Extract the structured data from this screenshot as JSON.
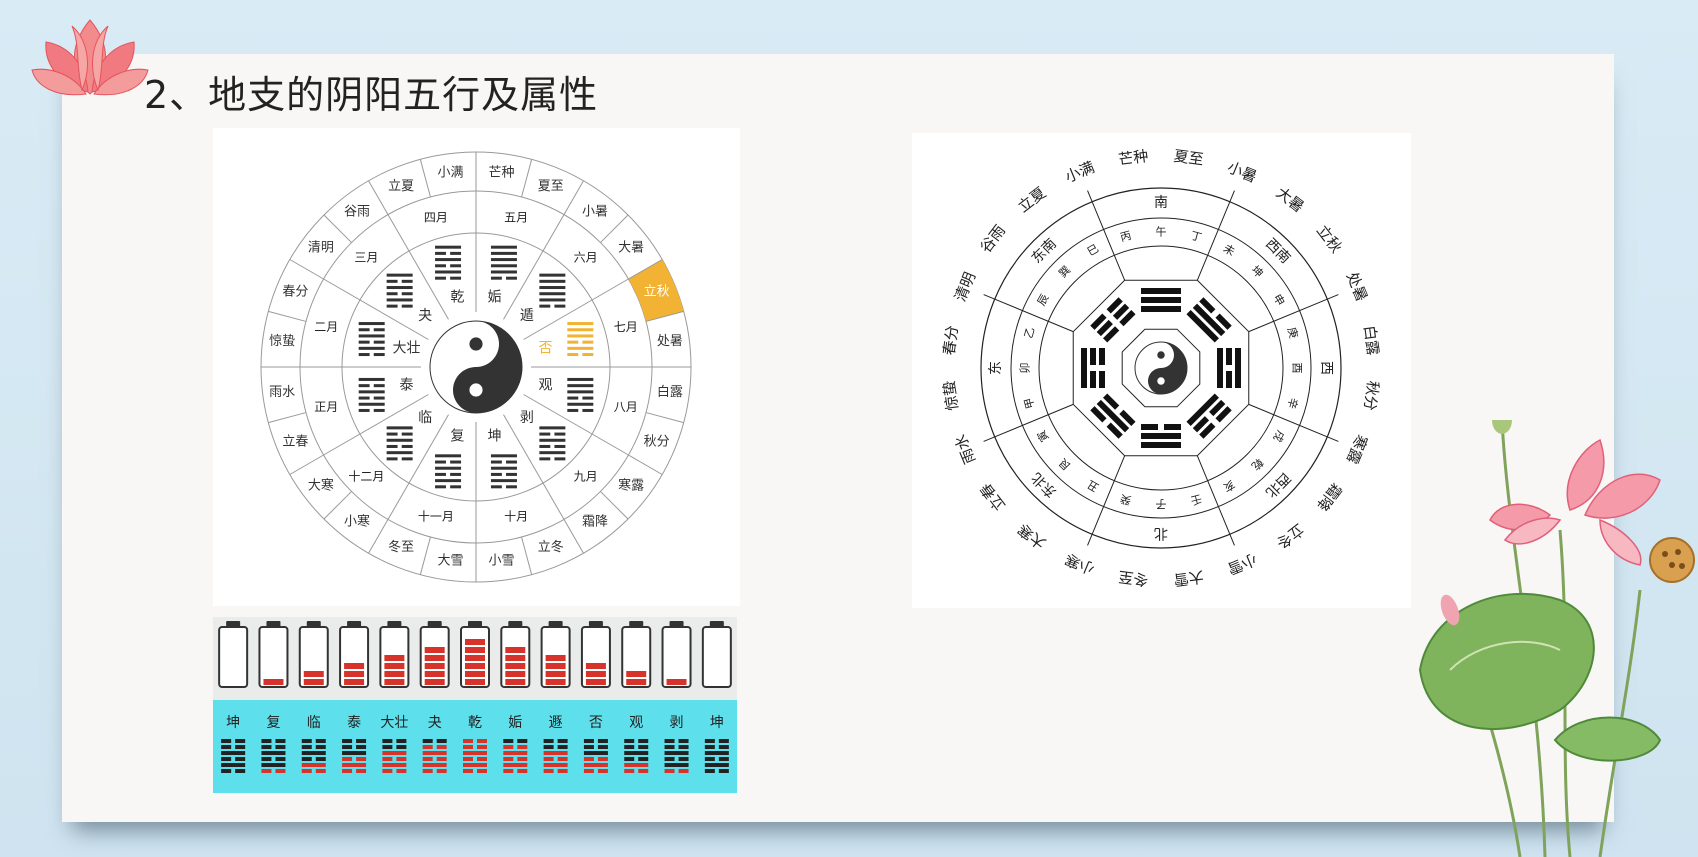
{
  "title": "2、地支的阴阳五行及属性",
  "wheel1": {
    "solar_terms": [
      "芒种",
      "夏至",
      "小暑",
      "大暑",
      "立秋",
      "处暑",
      "白露",
      "秋分",
      "寒露",
      "霜降",
      "立冬",
      "小雪",
      "大雪",
      "冬至",
      "小寒",
      "大寒",
      "立春",
      "雨水",
      "惊蛰",
      "春分",
      "清明",
      "谷雨",
      "立夏",
      "小满"
    ],
    "months": [
      "五月",
      "六月",
      "七月",
      "八月",
      "九月",
      "十月",
      "十一月",
      "十二月",
      "正月",
      "二月",
      "三月",
      "四月"
    ],
    "hexagrams": [
      "姤",
      "遁",
      "否",
      "观",
      "剥",
      "坤",
      "复",
      "临",
      "泰",
      "大壮",
      "夬",
      "乾"
    ],
    "highlight_term": "立秋",
    "highlight_color": "#f2b233"
  },
  "wheel2": {
    "outer_terms": [
      "夏至",
      "小暑",
      "大暑",
      "立秋",
      "处暑",
      "白露",
      "秋分",
      "寒露",
      "霜降",
      "立冬",
      "小雪",
      "大雪",
      "冬至",
      "小寒",
      "大寒",
      "立春",
      "雨水",
      "惊蛰",
      "春分",
      "清明",
      "谷雨",
      "立夏",
      "小满",
      "芒种"
    ],
    "directions": [
      "南",
      "西南",
      "西",
      "西北",
      "北",
      "东北",
      "东",
      "东南"
    ],
    "stems_branches": [
      "午",
      "丁",
      "未",
      "坤",
      "申",
      "庚",
      "酉",
      "辛",
      "戌",
      "乾",
      "亥",
      "壬",
      "子",
      "癸",
      "丑",
      "艮",
      "寅",
      "甲",
      "卯",
      "乙",
      "辰",
      "巽",
      "巳",
      "丙"
    ]
  },
  "strip": {
    "labels": [
      "坤",
      "复",
      "临",
      "泰",
      "大壮",
      "夬",
      "乾",
      "姤",
      "遯",
      "否",
      "观",
      "剥",
      "坤"
    ],
    "battery_levels": [
      0,
      1,
      2,
      3,
      4,
      5,
      6,
      5,
      4,
      3,
      2,
      1,
      0
    ],
    "fill_color": "#d8332a",
    "band_color": "#5ee0ec"
  }
}
